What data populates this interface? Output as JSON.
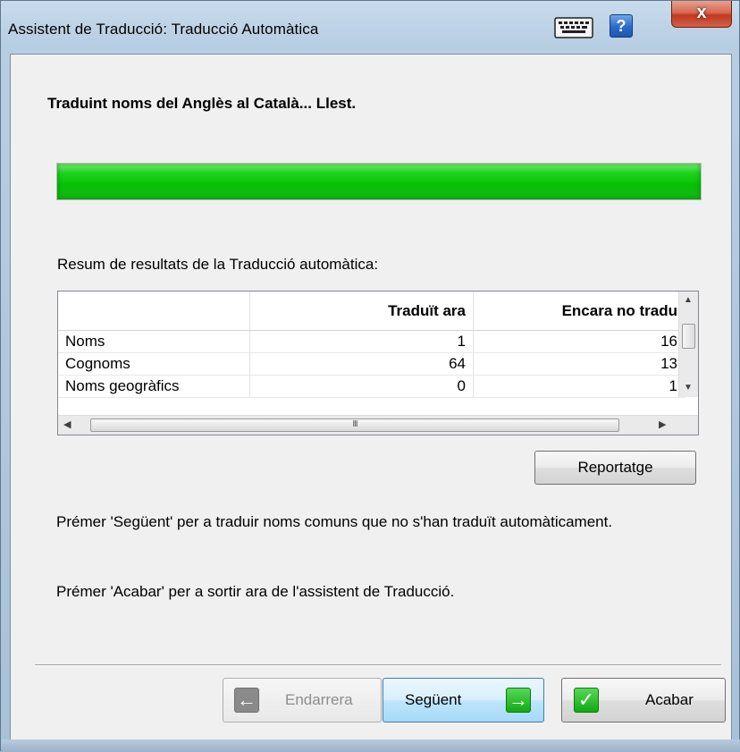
{
  "window": {
    "title": "Assistent de Traducció: Traducció Automàtica",
    "help_glyph": "?",
    "close_glyph": "x",
    "icons": [
      "keyboard-icon",
      "help-icon",
      "close-icon"
    ]
  },
  "status": {
    "text": "Traduint noms del Anglès al Català... Llest.",
    "progress_percent": 100,
    "progress_color": "#06c106"
  },
  "summary": {
    "label": "Resum de resultats de la Traducció automàtica:",
    "columns": [
      "",
      "Traduït ara",
      "Encara no tradu"
    ],
    "rows": [
      {
        "name": "Noms",
        "translated_now": "1",
        "not_yet": "16"
      },
      {
        "name": "Cognoms",
        "translated_now": "64",
        "not_yet": "13"
      },
      {
        "name": "Noms geogràfics",
        "translated_now": "0",
        "not_yet": "1"
      }
    ],
    "hscroll_grip": "III"
  },
  "buttons": {
    "report": "Reportatge",
    "back": "Endarrera",
    "next": "Següent",
    "finish": "Acabar"
  },
  "info": {
    "line1": "Prémer 'Següent' per a traduir noms comuns que no s'han traduït automàticament.",
    "line2": "Prémer 'Acabar' per a sortir ara de l'assistent de Traducció."
  }
}
